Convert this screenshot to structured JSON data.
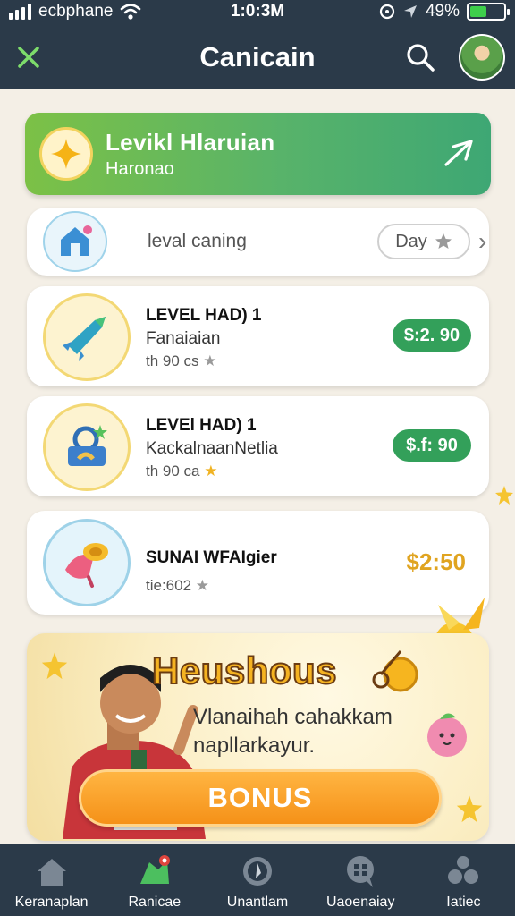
{
  "status_bar": {
    "carrier": "ecbphane",
    "time": "1:0:3M",
    "battery": "49%",
    "battery_level": 0.49
  },
  "header": {
    "title": "Canicain",
    "close_icon": "close-icon",
    "search_icon": "search-icon"
  },
  "hero": {
    "title": "Levikl Hlaruian",
    "subtitle": "Haronao",
    "accent": "#6dbb52"
  },
  "search_row": {
    "label": "leval caning",
    "pill_label": "Day"
  },
  "items": [
    {
      "name": "LEVEL HAD) 1",
      "desc": "Fanaiaian",
      "meta": "th 90 cs",
      "price": "$:2. 90",
      "price_style": "pill"
    },
    {
      "name": "LEVEl HAD) 1",
      "desc": "KackalnaanNetlia",
      "meta": "th 90 ca",
      "price": "$.f: 90",
      "price_style": "pill"
    },
    {
      "name": "SUNAI WFAIgier",
      "desc": "",
      "meta": "tie:602",
      "price": "$2:50",
      "price_style": "text"
    }
  ],
  "promo": {
    "heading": "Heushous",
    "line1": "Vlanaihah cahakkam",
    "line2": "napllarkayur.",
    "cta": "BONUS"
  },
  "bottom_nav": [
    {
      "label": "Keranaplan",
      "icon": "home-icon"
    },
    {
      "label": "Ranicae",
      "icon": "map-icon"
    },
    {
      "label": "Unantlam",
      "icon": "compass-icon"
    },
    {
      "label": "Uaoenaiay",
      "icon": "chat-icon"
    },
    {
      "label": "Iatiec",
      "icon": "people-icon"
    }
  ],
  "colors": {
    "header_bg": "#2b3a49",
    "page_bg": "#f4efe6",
    "price_green": "#33a05a",
    "price_gold": "#e0a420",
    "cta_orange": "#f59118"
  }
}
